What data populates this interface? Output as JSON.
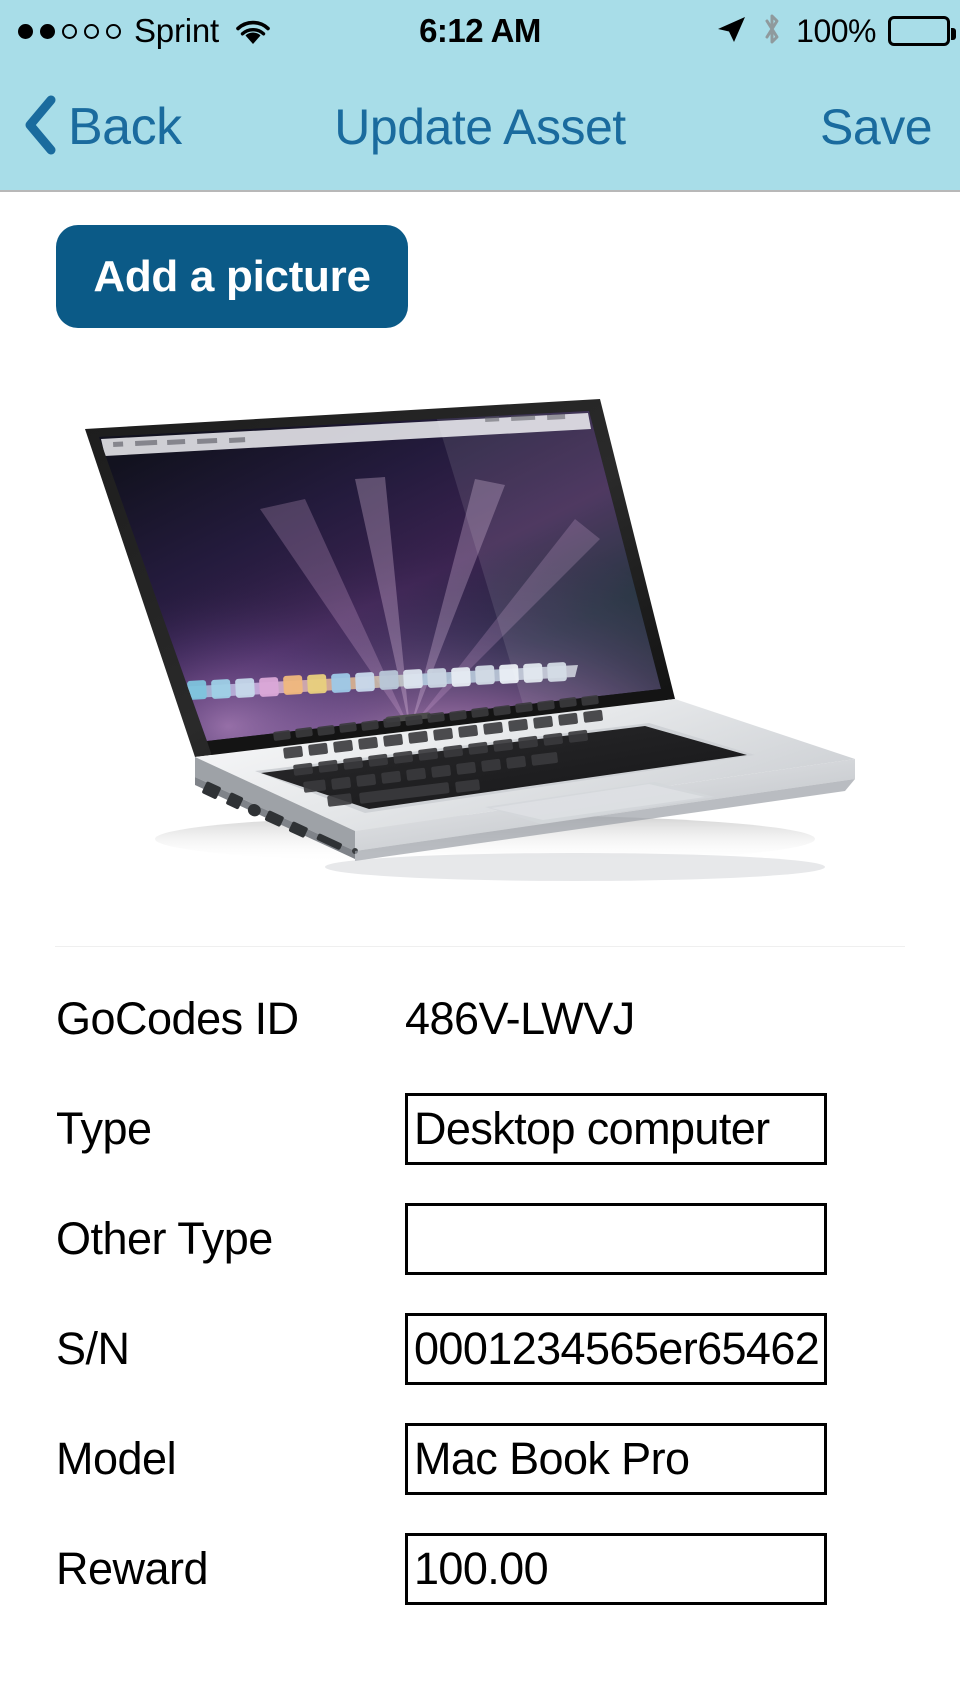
{
  "statusbar": {
    "signal_filled": 2,
    "signal_total": 5,
    "carrier": "Sprint",
    "wifi_icon": "wifi-icon",
    "time": "6:12 AM",
    "location_icon": "location-arrow-icon",
    "bluetooth_icon": "bluetooth-icon",
    "battery_percent": "100%",
    "battery_level": 100
  },
  "navbar": {
    "back_label": "Back",
    "back_icon": "chevron-left-icon",
    "title": "Update Asset",
    "save_label": "Save",
    "bg_color": "#a8dde8",
    "tint_color": "#1a6b9e"
  },
  "content": {
    "add_picture_label": "Add a picture",
    "add_picture_color": "#0b5a87",
    "asset_photo_alt": "MacBook Pro laptop open showing aurora wallpaper"
  },
  "form": {
    "rows": [
      {
        "label": "GoCodes ID",
        "value": "486V-LWVJ",
        "type": "text",
        "name": "gocodes-id"
      },
      {
        "label": "Type",
        "value": "Desktop computer",
        "type": "input",
        "name": "type"
      },
      {
        "label": "Other Type",
        "value": "",
        "type": "input",
        "name": "other-type"
      },
      {
        "label": "S/N",
        "value": "0001234565er65462…",
        "type": "input",
        "name": "serial-number"
      },
      {
        "label": "Model",
        "value": "Mac Book Pro",
        "type": "input",
        "name": "model"
      },
      {
        "label": "Reward",
        "value": "100.00",
        "type": "input",
        "name": "reward"
      }
    ]
  }
}
